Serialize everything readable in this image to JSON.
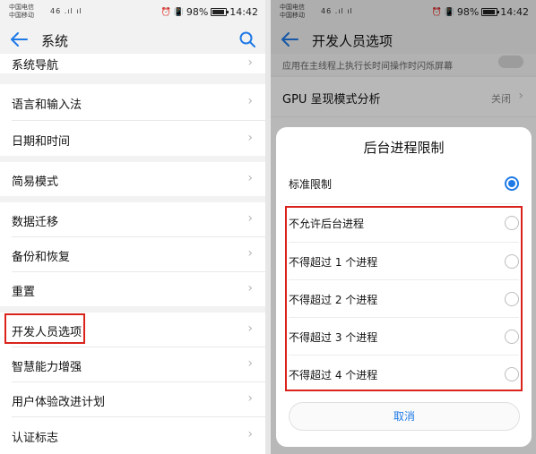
{
  "left": {
    "status": {
      "carrier1": "中国电信",
      "carrier2": "中国移动",
      "signal": "46 .ıl ıl",
      "icons": "⏰ 📳",
      "battery": "98%",
      "time": "14:42"
    },
    "header": {
      "title": "系统"
    },
    "items": [
      {
        "label": "系统导航"
      },
      {
        "label": "语言和输入法"
      },
      {
        "label": "日期和时间"
      },
      {
        "label": "简易模式"
      },
      {
        "label": "数据迁移"
      },
      {
        "label": "备份和恢复"
      },
      {
        "label": "重置"
      },
      {
        "label": "开发人员选项"
      },
      {
        "label": "智慧能力增强"
      },
      {
        "label": "用户体验改进计划"
      },
      {
        "label": "认证标志"
      }
    ],
    "accent": "#1f7ae6",
    "highlight_color": "#d9231b"
  },
  "right": {
    "status": {
      "carrier1": "中国电信",
      "carrier2": "中国移动",
      "signal": "46 .ıl ıl",
      "icons": "⏰ 📳",
      "battery": "98%",
      "time": "14:42"
    },
    "header": {
      "title": "开发人员选项"
    },
    "bg_subtitle": "应用在主线程上执行长时间操作时闪烁屏幕",
    "gpu_label": "GPU 呈现模式分析",
    "gpu_value": "关闭",
    "dialog": {
      "title": "后台进程限制",
      "options": [
        {
          "label": "标准限制",
          "selected": true
        },
        {
          "label": "不允许后台进程",
          "selected": false
        },
        {
          "label": "不得超过 1 个进程",
          "selected": false
        },
        {
          "label": "不得超过 2 个进程",
          "selected": false
        },
        {
          "label": "不得超过 3 个进程",
          "selected": false
        },
        {
          "label": "不得超过 4 个进程",
          "selected": false
        }
      ],
      "cancel_label": "取消"
    }
  }
}
